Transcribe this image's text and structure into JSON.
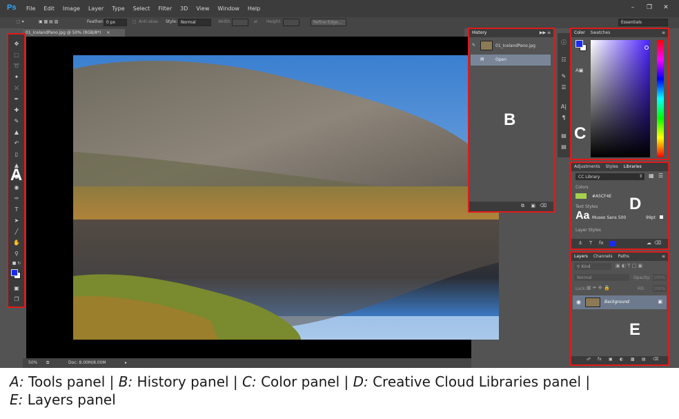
{
  "app": {
    "logo": "Ps"
  },
  "menu": [
    "File",
    "Edit",
    "Image",
    "Layer",
    "Type",
    "Select",
    "Filter",
    "3D",
    "View",
    "Window",
    "Help"
  ],
  "options_bar": {
    "feather_label": "Feather:",
    "feather_value": "0 px",
    "antialias_label": "Anti-alias",
    "style_label": "Style:",
    "style_value": "Normal",
    "width_label": "Width:",
    "height_label": "Height:",
    "refine_edge": "Refine Edge...",
    "workspace": "Essentials"
  },
  "document_tab": "01_IcelandPano.jpg @ 50% (RGB/8*)",
  "status_bar": {
    "zoom": "50%",
    "doc": "Doc: 8.00M/8.00M"
  },
  "history_panel": {
    "title": "History",
    "snapshot": "01_IcelandPano.jpg",
    "state": "Open"
  },
  "color_panel": {
    "tabs": [
      "Color",
      "Swatches"
    ]
  },
  "libraries_panel": {
    "tabs": [
      "Adjustments",
      "Styles",
      "Libraries"
    ],
    "library": "CC Library",
    "colors_heading": "Colors",
    "color_hex": "#A5CF4E",
    "text_styles_heading": "Text Styles",
    "text_style_name": "Museo Sans 500",
    "text_style_size": "99pt",
    "layer_styles_heading": "Layer Styles"
  },
  "layers_panel": {
    "tabs": [
      "Layers",
      "Channels",
      "Paths"
    ],
    "kind": "Kind",
    "blend_mode": "Normal",
    "opacity_label": "Opacity:",
    "opacity_value": "100%",
    "lock_label": "Lock:",
    "fill_label": "Fill:",
    "fill_value": "100%",
    "layer_name": "Background"
  },
  "panel_labels": {
    "A": "A",
    "B": "B",
    "C": "C",
    "D": "D",
    "E": "E"
  },
  "caption": {
    "a_key": "A:",
    "a_text": " Tools panel | ",
    "b_key": "B:",
    "b_text": " History panel | ",
    "c_key": "C:",
    "c_text": " Color panel | ",
    "d_key": "D:",
    "d_text": " Creative Cloud Libraries panel |",
    "e_key": "E:",
    "e_text": " Layers panel"
  },
  "colors": {
    "highlight": "#e01a1a",
    "foreground": "#1a2bf0",
    "library_swatch": "#a5cf4e",
    "ps_blue": "#31a8ff"
  }
}
